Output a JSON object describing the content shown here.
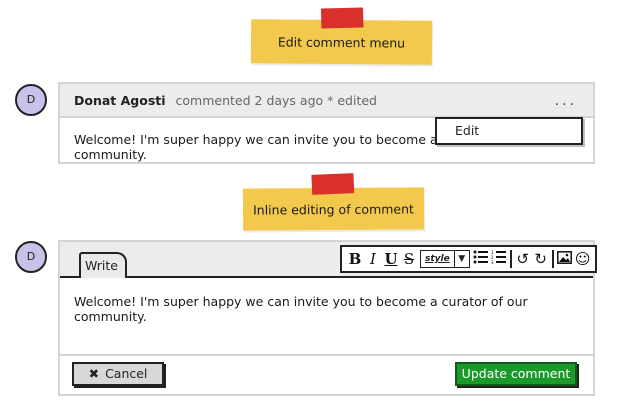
{
  "annotations": {
    "note1": "Edit comment menu",
    "note2": "Inline editing of comment"
  },
  "comment": {
    "avatar": "D",
    "author": "Donat Agosti",
    "meta": "commented 2 days ago * edited",
    "more_icon": "more-dots-icon",
    "text": "Welcome! I'm super happy we can invite you to become a curator of our community.",
    "menu": {
      "items": [
        "Edit"
      ]
    }
  },
  "editor": {
    "avatar": "D",
    "tab": "Write",
    "toolbar": {
      "bold": "B",
      "italic": "I",
      "underline": "U",
      "strike": "S",
      "style": "style",
      "icons": [
        "bulleted-list-icon",
        "numbered-list-icon",
        "undo-icon",
        "redo-icon",
        "image-icon",
        "emoji-icon"
      ]
    },
    "text": "Welcome! I'm super happy we can invite you to become a curator of our community.",
    "cancel": "Cancel",
    "update": "Update comment"
  },
  "colors": {
    "sticky": "#f2c94c",
    "tape": "#d9302c",
    "avatar": "#c9c2e8",
    "update_button": "#1a9a2a"
  }
}
